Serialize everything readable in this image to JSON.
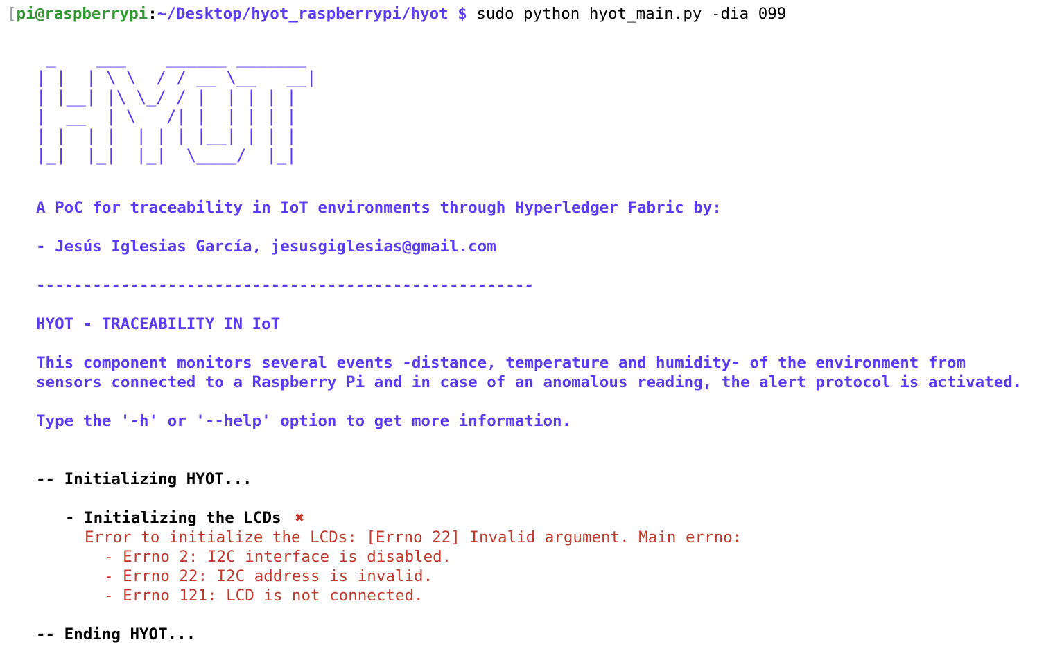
{
  "prompt": {
    "bracket": "[",
    "user_host": "pi@raspberrypi",
    "separator": ":",
    "path": "~/Desktop/hyot_raspberrypi/hyot",
    "symbol": "$",
    "command": "sudo python hyot_main.py -dia 099"
  },
  "banner": {
    "ascii_art": " _    ___    ______ _______\n| |  | \\ \\  / / __ \\__   __|\n| |__| |\\ \\_/ / |  | | | |\n|  __  | \\   /| |  | | | |\n| |  | |  | | | |__| | | |\n|_|  |_|  |_|  \\____/  |_|"
  },
  "intro": {
    "poc_line": "A PoC for traceability in IoT environments through Hyperledger Fabric by:",
    "author_line": "- Jesús Iglesias García, jesusgiglesias@gmail.com",
    "separator": "-----------------------------------------------------",
    "title": "HYOT - TRACEABILITY IN IoT",
    "description_line1": "This component monitors several events -distance, temperature and humidity- of the environment from",
    "description_line2": "sensors connected to a Raspberry Pi and in case of an anomalous reading, the alert protocol is activated.",
    "help_line": "Type the '-h' or '--help' option to get more information."
  },
  "log": {
    "initializing": "-- Initializing HYOT...",
    "lcd_step": "- Initializing the LCDs",
    "lcd_status_icon": "✖",
    "lcd_error": "Error to initialize the LCDs: [Errno 22] Invalid argument. Main errno:",
    "errno_items": [
      "- Errno 2: I2C interface is disabled.",
      "- Errno 22: I2C address is invalid.",
      "- Errno 121: LCD is not connected."
    ],
    "ending": "-- Ending HYOT..."
  },
  "colors": {
    "prompt_green": "#2f9a2f",
    "banner_blue": "#5a3cf0",
    "error_red": "#c0392b"
  }
}
